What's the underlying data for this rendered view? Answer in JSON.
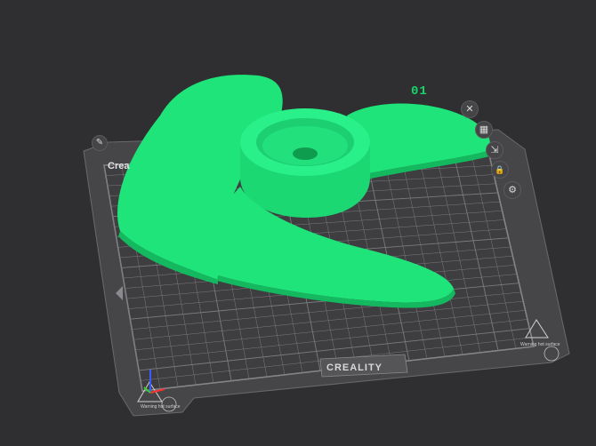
{
  "plate": {
    "number": "01",
    "brand_corner": "Crea",
    "brand_bottom": "CREALITY",
    "warning_left": "Warning hot surface",
    "warning_right": "Warning hot surface"
  },
  "toolbar": {
    "close_glyph": "✕",
    "arrange_glyph": "▦",
    "autoorient_glyph": "⇲",
    "lock_glyph": "🔒",
    "settings_glyph": "⚙",
    "edit_glyph": "✎"
  },
  "colors": {
    "background": "#2f2f31",
    "plate": "#444446",
    "grid": "#8d8d90",
    "model": "#1ee47a",
    "model_shadow": "#14b85f",
    "accent": "#19d36a"
  },
  "icons": [
    "close-icon",
    "arrange-icon",
    "auto-orient-icon",
    "lock-icon",
    "settings-icon",
    "edit-icon",
    "axis-gizmo"
  ]
}
